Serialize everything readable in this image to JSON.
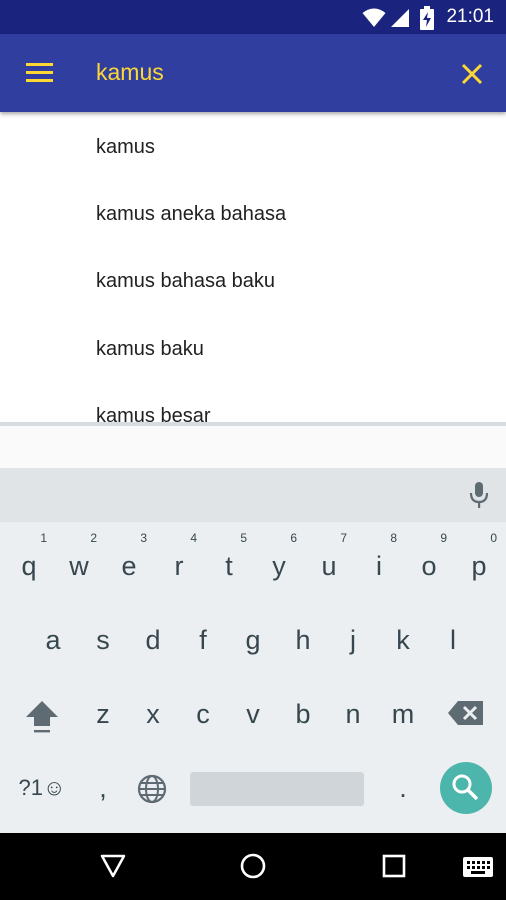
{
  "status_bar": {
    "time": "21:01",
    "icons": [
      "wifi-icon",
      "signal-icon",
      "battery-charging-icon"
    ]
  },
  "app_bar": {
    "menu_icon": "hamburger-menu-icon",
    "search_value": "kamus",
    "close_icon": "close-icon",
    "colors": {
      "background": "#303f9f",
      "accent": "#fdd835"
    }
  },
  "suggestions": [
    "kamus",
    "kamus aneka bahasa",
    "kamus bahasa baku",
    "kamus baku",
    "kamus besar"
  ],
  "keyboard": {
    "mic_icon": "microphone-icon",
    "row1": [
      {
        "key": "q",
        "hint": "1"
      },
      {
        "key": "w",
        "hint": "2"
      },
      {
        "key": "e",
        "hint": "3"
      },
      {
        "key": "r",
        "hint": "4"
      },
      {
        "key": "t",
        "hint": "5"
      },
      {
        "key": "y",
        "hint": "6"
      },
      {
        "key": "u",
        "hint": "7"
      },
      {
        "key": "i",
        "hint": "8"
      },
      {
        "key": "o",
        "hint": "9"
      },
      {
        "key": "p",
        "hint": "0"
      }
    ],
    "row2": [
      "a",
      "s",
      "d",
      "f",
      "g",
      "h",
      "j",
      "k",
      "l"
    ],
    "row3": [
      "z",
      "x",
      "c",
      "v",
      "b",
      "n",
      "m"
    ],
    "bottom": {
      "symbols_label": "?1☺",
      "comma": ",",
      "period": ".",
      "globe_icon": "globe-icon",
      "search_icon": "search-icon",
      "shift_icon": "shift-icon",
      "backspace_icon": "backspace-icon"
    }
  },
  "nav_bar": {
    "icons": [
      "back-icon",
      "home-icon",
      "recents-icon",
      "keyboard-switch-icon"
    ]
  }
}
